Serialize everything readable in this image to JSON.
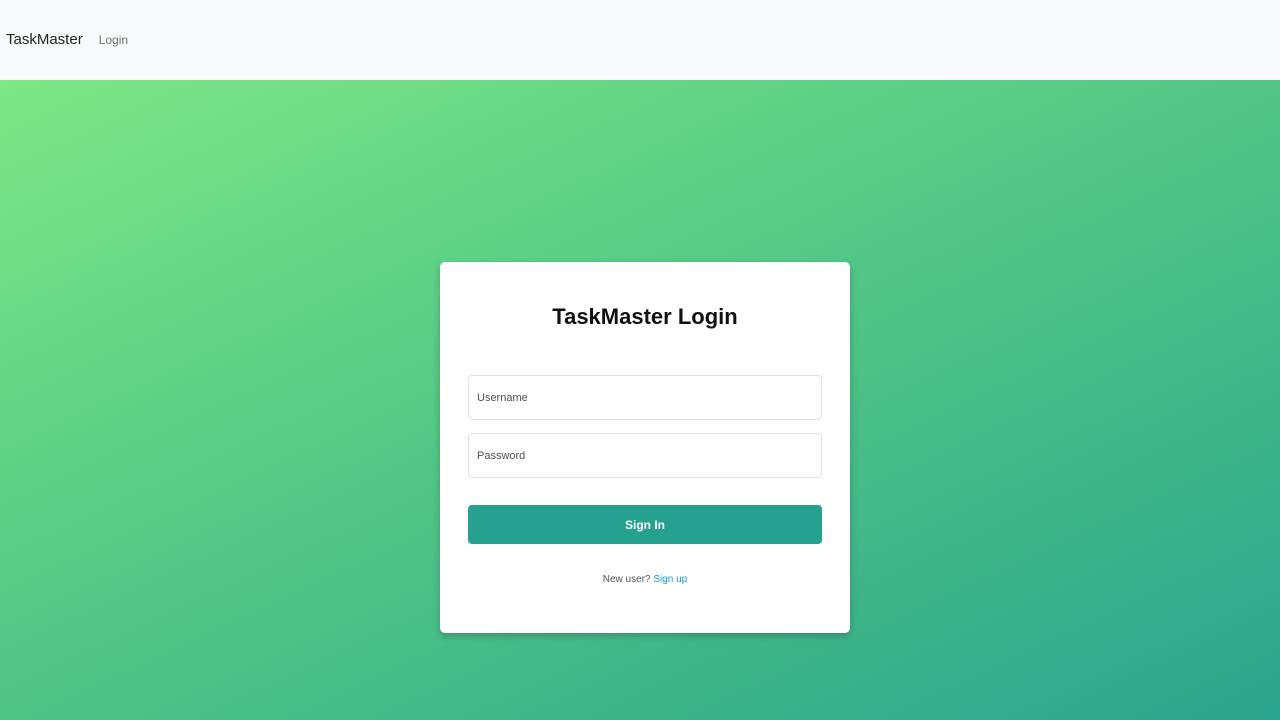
{
  "navbar": {
    "brand": "TaskMaster",
    "links": [
      {
        "label": "Login"
      }
    ]
  },
  "login_card": {
    "title": "TaskMaster Login",
    "username": {
      "placeholder": "Username",
      "value": ""
    },
    "password": {
      "placeholder": "Password",
      "value": ""
    },
    "submit_label": "Sign In",
    "signup_prompt": "New user?",
    "signup_link": "Sign up"
  },
  "colors": {
    "navbar_bg": "#f8f9fa",
    "gradient_start": "#7ee787",
    "gradient_end": "#2aa58d",
    "button_bg": "#26a08f",
    "link": "#1a9ec2"
  }
}
